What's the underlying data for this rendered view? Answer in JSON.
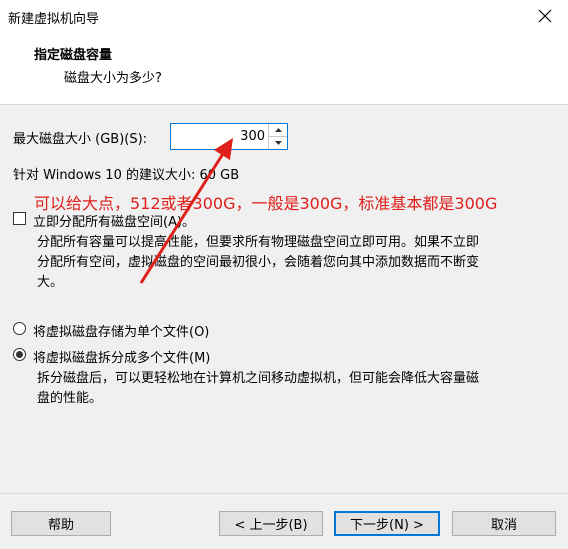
{
  "window": {
    "title": "新建虚拟机向导"
  },
  "header": {
    "title": "指定磁盘容量",
    "subtitle": "磁盘大小为多少?"
  },
  "disk": {
    "size_label": "最大磁盘大小 (GB)(S):",
    "size_value": "300",
    "recommend_text": "针对 Windows 10 的建议大小: 60 GB"
  },
  "annotation": {
    "text": "可以给大点，512或者300G，一般是300G，标准基本都是300G",
    "color": "#e0201b"
  },
  "allocate": {
    "label": "立即分配所有磁盘空间(A)。",
    "checked": false,
    "description_line1": "分配所有容量可以提高性能，但要求所有物理磁盘空间立即可用。如果不立即",
    "description_line2": "分配所有空间，虚拟磁盘的空间最初很小，会随着您向其中添加数据而不断变",
    "description_line3": "大。"
  },
  "storage": {
    "single_label": "将虚拟磁盘存储为单个文件(O)",
    "multi_label": "将虚拟磁盘拆分成多个文件(M)",
    "selected": "multi",
    "multi_description_line1": "拆分磁盘后，可以更轻松地在计算机之间移动虚拟机，但可能会降低大容量磁",
    "multi_description_line2": "盘的性能。"
  },
  "footer": {
    "help": "帮助",
    "back": "< 上一步(B)",
    "next": "下一步(N) >",
    "cancel": "取消"
  }
}
